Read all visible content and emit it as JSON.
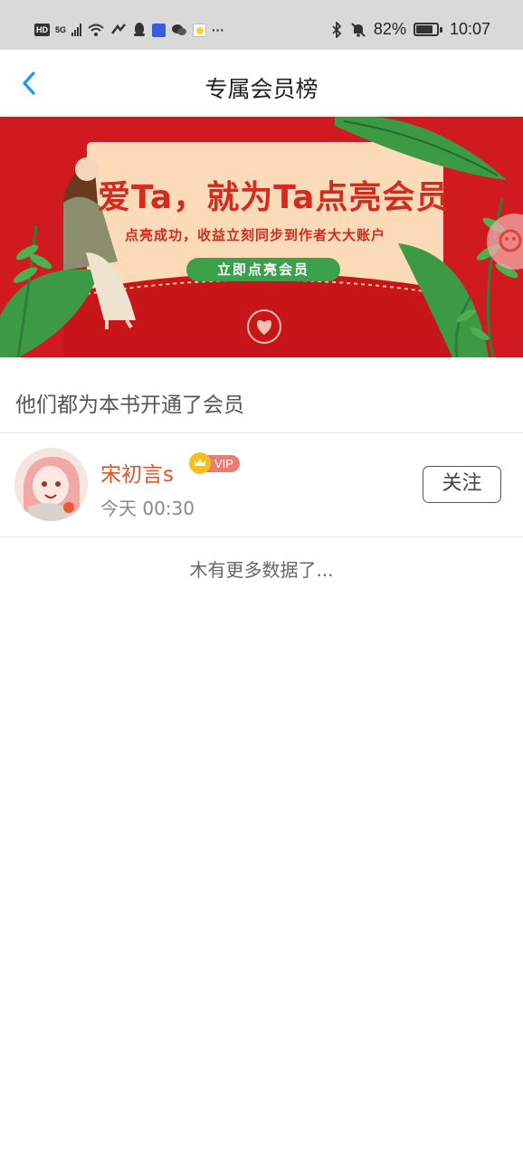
{
  "status_bar": {
    "network": "5G",
    "battery_percent": "82%",
    "battery_level": 0.82,
    "time": "10:07",
    "more": "···"
  },
  "nav": {
    "title": "专属会员榜"
  },
  "banner": {
    "title": "爱Ta，就为Ta点亮会员",
    "subtitle": "点亮成功，收益立刻同步到作者大大账户",
    "button": "立即点亮会员"
  },
  "section": {
    "title": "他们都为本书开通了会员"
  },
  "members": [
    {
      "name": "宋初言s",
      "badge": "VIP",
      "time": "今天 00:30",
      "action": "关注"
    }
  ],
  "footer": {
    "no_more": "木有更多数据了..."
  },
  "colors": {
    "accent_blue": "#1a9ee8",
    "name_red": "#e0522c",
    "banner_red": "#d01a1f",
    "banner_green": "#3aa14a"
  }
}
